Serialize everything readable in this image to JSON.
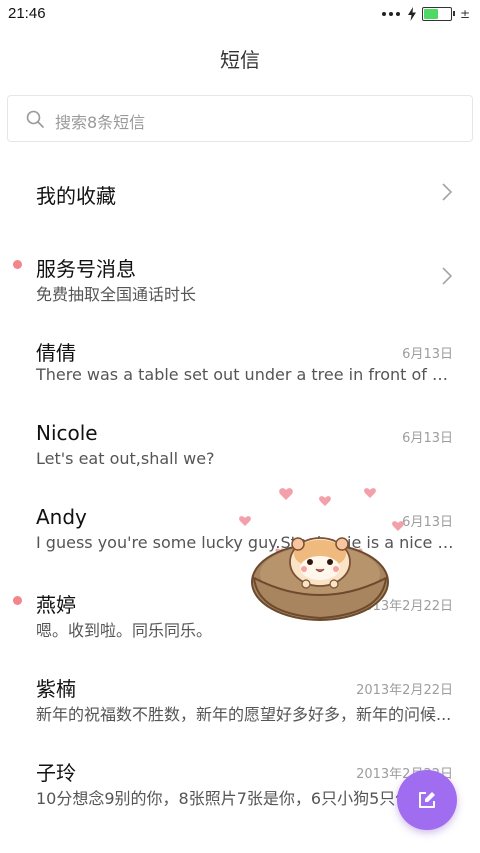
{
  "status_bar": {
    "time": "21:46",
    "battery_level": 0.55,
    "charging": true,
    "extra_symbol": "±"
  },
  "header": {
    "title": "短信"
  },
  "search": {
    "placeholder": "搜索8条短信",
    "icon": "search-icon"
  },
  "conversations": [
    {
      "name": "我的收藏",
      "preview": "",
      "date": "",
      "unread": false,
      "chevron": true
    },
    {
      "name": "服务号消息",
      "preview": "免费抽取全国通话时长",
      "date": "",
      "unread": true,
      "chevron": true
    },
    {
      "name": "倩倩",
      "preview": "There was a table set out under a tree in front of the ho...",
      "date": "6月13日",
      "unread": false,
      "chevron": false
    },
    {
      "name": "Nicole",
      "preview": "Let's eat out,shall we?",
      "date": "6月13日",
      "unread": false,
      "chevron": false
    },
    {
      "name": "Andy",
      "preview": "I guess you're some lucky guy.Stephanie is a nice girl.",
      "date": "6月13日",
      "unread": false,
      "chevron": false
    },
    {
      "name": "燕婷",
      "preview": "嗯。收到啦。同乐同乐。",
      "date": "2013年2月22日",
      "unread": true,
      "chevron": false
    },
    {
      "name": "紫楠",
      "preview": "新年的祝福数不胜数，新年的愿望好多好多，新年的问候...",
      "date": "2013年2月22日",
      "unread": false,
      "chevron": false
    },
    {
      "name": "子玲",
      "preview": "10分想念9别的你，8张照片7张是你，6只小狗5只像你",
      "date": "2013年2月22日",
      "unread": false,
      "chevron": false
    }
  ],
  "fab": {
    "icon": "compose-icon",
    "color": "#a06cf0"
  },
  "colors": {
    "unread_dot": "#f2868c",
    "date": "#9d9d9d",
    "accent": "#a06cf0"
  }
}
